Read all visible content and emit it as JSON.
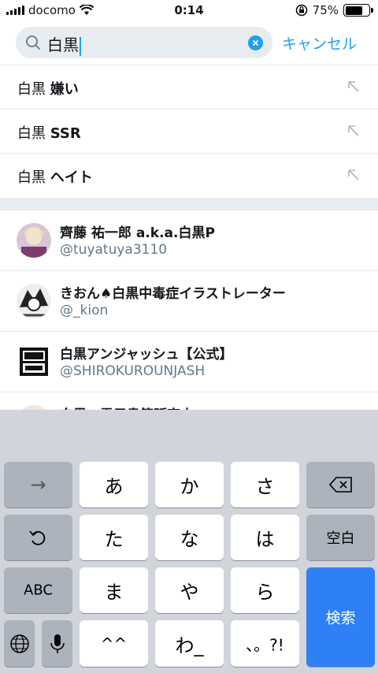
{
  "status_bar": {
    "carrier": "docomo",
    "time": "0:14",
    "battery": "75%",
    "battery_level": 0.75
  },
  "search": {
    "query": "白黒",
    "cancel_label": "キャンセル"
  },
  "suggestions": [
    {
      "query": "白黒",
      "rest": "嫌い"
    },
    {
      "query": "白黒",
      "rest": "SSR"
    },
    {
      "query": "白黒",
      "rest": "ヘイト"
    }
  ],
  "users": [
    {
      "name": "齊藤 祐一郎 a.k.a.白黒P",
      "handle": "@tuyatuya3110"
    },
    {
      "name": "きおん♠白黒中毒症イラストレーター",
      "handle": "@_kion"
    },
    {
      "name": "白黒アンジャッシュ【公式】",
      "handle": "@SHIROKURO​UNJASH"
    },
    {
      "name": "白黒@電子書籍販売中",
      "handle": ""
    }
  ],
  "keyboard": {
    "row1": [
      "→",
      "あ",
      "か",
      "さ",
      "⌫"
    ],
    "row2": [
      "↺",
      "た",
      "な",
      "は",
      "空白"
    ],
    "row3": [
      "ABC",
      "ま",
      "や",
      "ら",
      "検索"
    ],
    "row4": [
      "🌐",
      "🎤",
      "^^",
      "わ_",
      "、。?!"
    ]
  },
  "colors": {
    "accent": "#1da1f2",
    "keyboard_bg": "#d1d5db",
    "search_key": "#2f80f7"
  }
}
